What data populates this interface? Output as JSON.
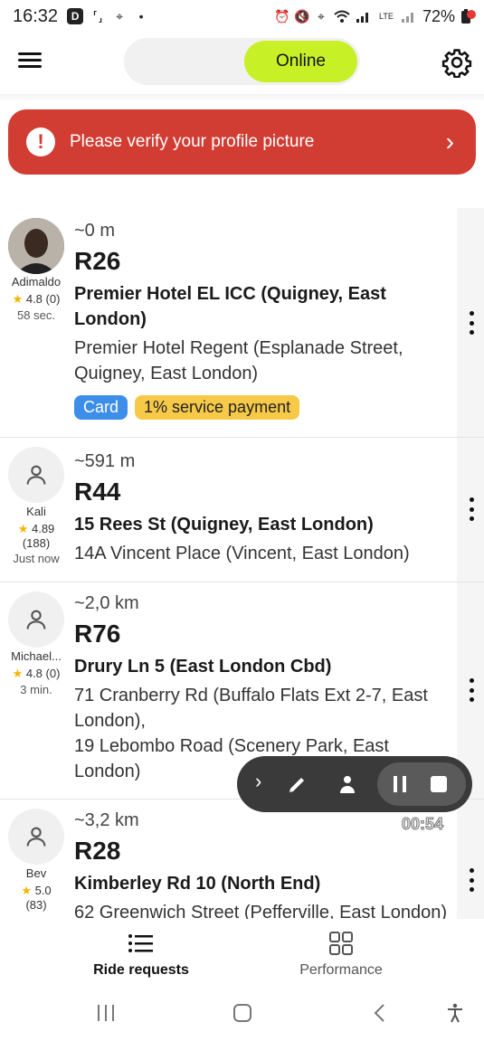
{
  "status_bar": {
    "time": "16:32",
    "battery": "72%",
    "left_icons": [
      "d-badge-icon",
      "screenshot-icon",
      "location-icon",
      "dot-icon"
    ],
    "right_icons": [
      "alarm-icon",
      "mute-icon",
      "location-icon",
      "wifi-icon",
      "signal-icon",
      "lte-icon",
      "battery-icon"
    ]
  },
  "header": {
    "status_toggle_label": "Online",
    "accent": "#c8f026"
  },
  "banner": {
    "text": "Please verify your profile picture",
    "color": "#d23d33"
  },
  "rides": [
    {
      "user_name": "Adimaldo",
      "rating": "4.8 (0)",
      "rating_count": "",
      "ago": "58 sec.",
      "distance": "~0 m",
      "price": "R26",
      "pickup": "Premier Hotel EL ICC (Quigney, East London)",
      "destination": "Premier Hotel Regent (Esplanade Street, Quigney, East London)",
      "tags": [
        "Card",
        "1% service payment"
      ]
    },
    {
      "user_name": "Kali",
      "rating": "4.89",
      "rating_count": "(188)",
      "ago": "Just now",
      "distance": "~591 m",
      "price": "R44",
      "pickup": "15 Rees St (Quigney, East London)",
      "destination": "14A Vincent Place (Vincent, East London)"
    },
    {
      "user_name": "Michael...",
      "rating": "4.8 (0)",
      "rating_count": "",
      "ago": "3 min.",
      "distance": "~2,0 km",
      "price": "R76",
      "pickup": "Drury Ln 5 (East London Cbd)",
      "destination": "71 Cranberry Rd (Buffalo Flats Ext 2-7, East London),",
      "destination2": "19 Lebombo Road (Scenery Park, East London)"
    },
    {
      "user_name": "Bev",
      "rating": "5.0",
      "rating_count": "(83)",
      "ago": "",
      "distance": "~3,2 km",
      "price": "R28",
      "pickup": "Kimberley Rd 10 (North End)",
      "destination": "62 Greenwich Street (Pefferville, East London)"
    }
  ],
  "recorder": {
    "timer": "00:54"
  },
  "bottom_nav": {
    "items": [
      {
        "label": "Ride requests",
        "icon": "list-icon",
        "active": true
      },
      {
        "label": "Performance",
        "icon": "grid-icon",
        "active": false
      }
    ]
  },
  "system_nav": [
    "recents-icon",
    "home-icon",
    "back-icon",
    "accessibility-icon"
  ]
}
